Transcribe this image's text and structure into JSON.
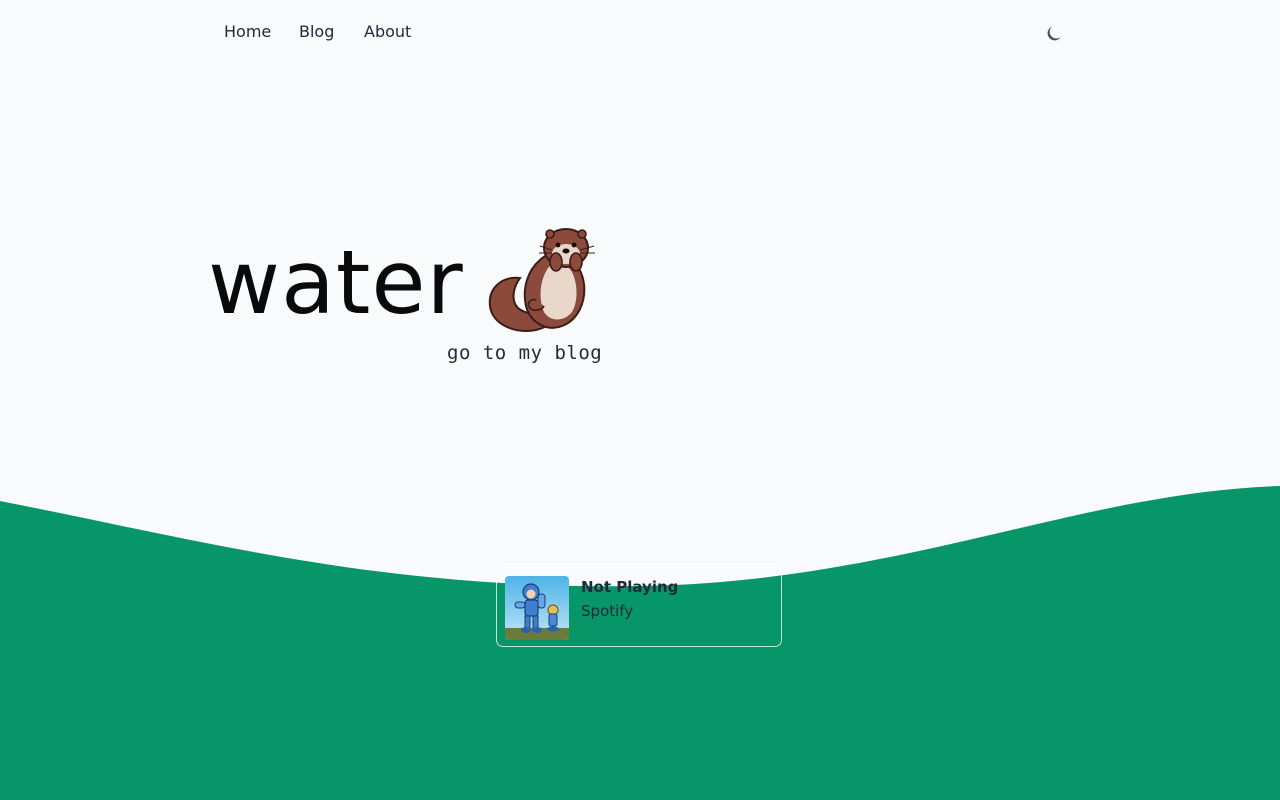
{
  "nav": {
    "items": [
      {
        "label": "Home"
      },
      {
        "label": "Blog"
      },
      {
        "label": "About"
      }
    ],
    "theme_toggle_icon": "moon-icon"
  },
  "hero": {
    "title": "water",
    "mascot_icon": "otter-icon",
    "blog_link": "go to my blog"
  },
  "now_playing": {
    "status": "Not Playing",
    "service": "Spotify",
    "album_art_icon": "album-art-icon"
  },
  "colors": {
    "background": "#f8fafc",
    "wave": "#069668",
    "text": "#1f2937"
  }
}
